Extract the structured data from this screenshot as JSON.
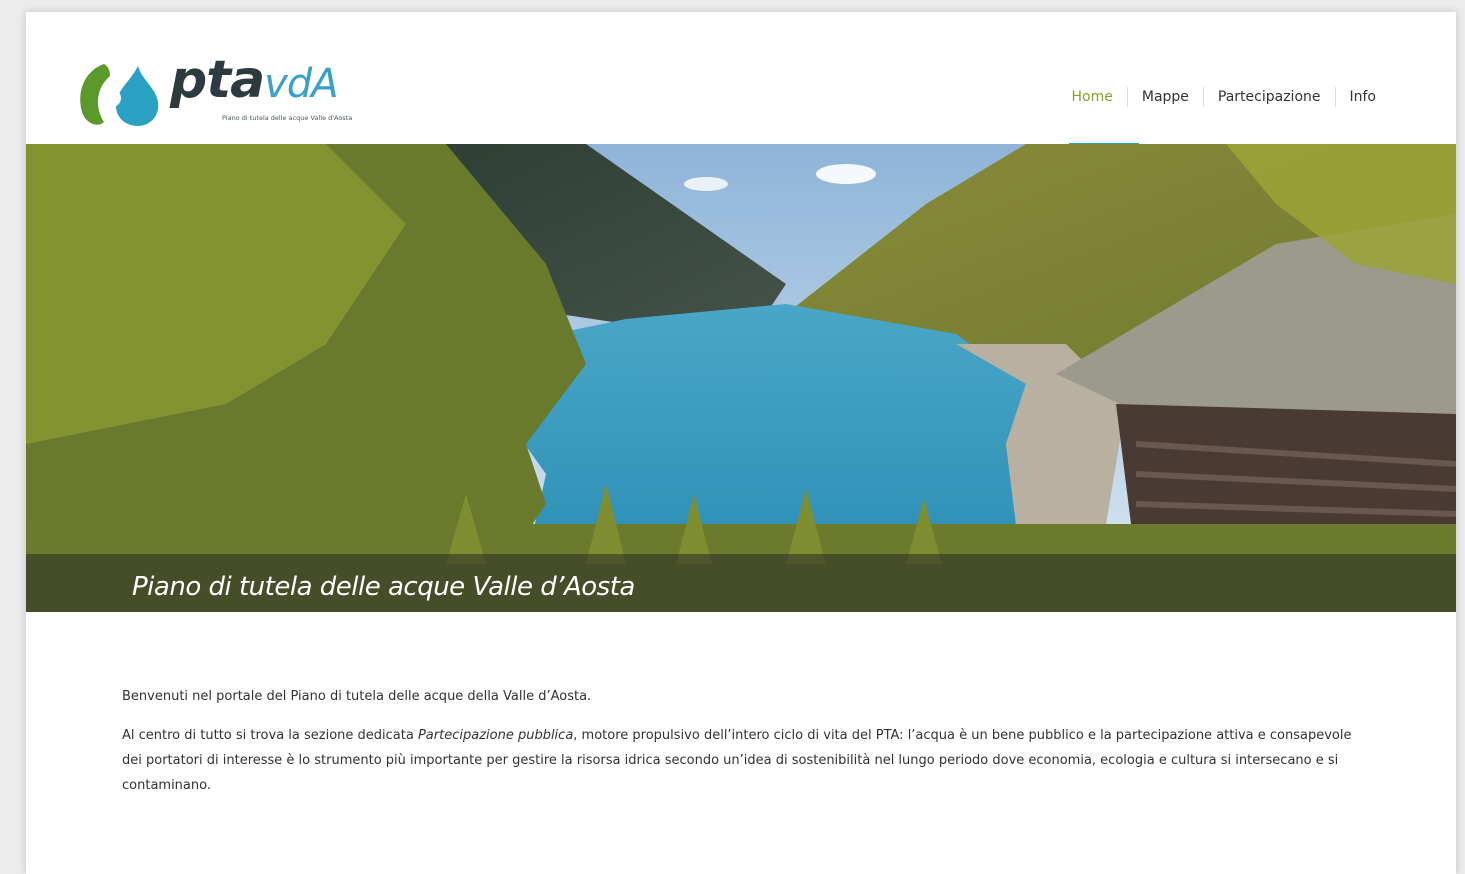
{
  "brand": {
    "name_main": "pta",
    "name_suffix": "vdA",
    "tagline": "Piano di tutela delle acque Valle d'Aosta"
  },
  "nav": {
    "items": [
      {
        "label": "Home",
        "active": true
      },
      {
        "label": "Mappe",
        "active": false
      },
      {
        "label": "Partecipazione",
        "active": false
      },
      {
        "label": "Info",
        "active": false
      }
    ]
  },
  "hero": {
    "caption": "Piano di tutela delle acque Valle d’Aosta"
  },
  "content": {
    "intro": "Benvenuti nel portale del Piano di tutela delle acque della Valle d’Aosta.",
    "body_before": "Al centro di tutto si trova la sezione dedicata ",
    "body_emphasis": "Partecipazione pubblica",
    "body_after": ", motore propulsivo dell’intero ciclo di vita del PTA: l’acqua è un bene pubblico e la partecipazione attiva e consapevole dei portatori di interesse è lo strumento più importante per gestire la risorsa idrica secondo un’idea di sostenibilità nel lungo periodo dove economia, ecologia e cultura si intersecano e si contaminano."
  },
  "colors": {
    "nav_active": "#8aa02a",
    "accent_blue": "#2aa0c2",
    "logo_green": "#5a9a2a"
  }
}
